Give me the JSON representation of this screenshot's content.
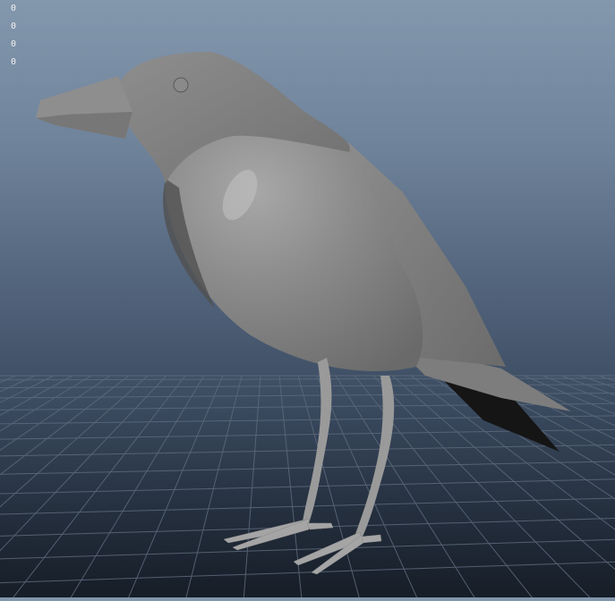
{
  "viewport": {
    "hud_values": [
      "0",
      "0",
      "0",
      "0"
    ],
    "model": "crow-mesh",
    "background_top": "#8397ad",
    "background_bottom": "#161d27",
    "grid_color": "#5d6a7c",
    "mesh_color": "#7a7a7a"
  }
}
